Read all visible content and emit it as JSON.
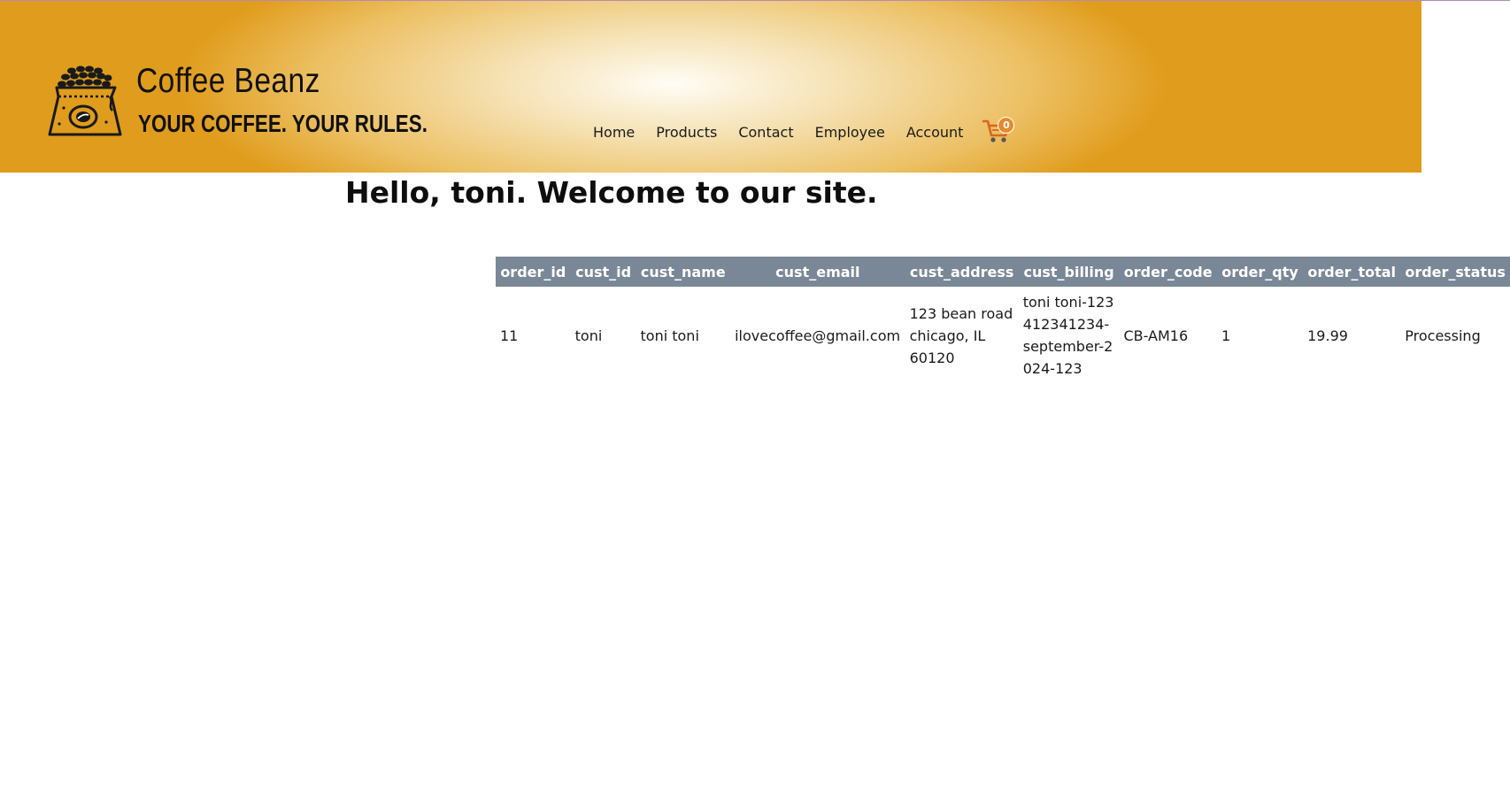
{
  "brand": {
    "name": "Coffee Beanz",
    "slogan": "YOUR COFFEE. YOUR RULES."
  },
  "nav": {
    "items": [
      "Home",
      "Products",
      "Contact",
      "Employee",
      "Account"
    ],
    "cart_count": "0",
    "cart_icon": "shopping-cart-icon"
  },
  "welcome": "Hello, toni. Welcome to our site.",
  "orders": {
    "columns": [
      "order_id",
      "cust_id",
      "cust_name",
      "cust_email",
      "cust_address",
      "cust_billing",
      "order_code",
      "order_qty",
      "order_total",
      "order_status"
    ],
    "rows": [
      {
        "order_id": "11",
        "cust_id": "toni",
        "cust_name": "toni toni",
        "cust_email": "ilovecoffee@gmail.com",
        "cust_address": "123 bean road chicago, IL 60120",
        "cust_billing": "toni toni-123412341234-september-2024-123",
        "order_code": "CB-AM16",
        "order_qty": "1",
        "order_total": "19.99",
        "order_status": "Processing"
      }
    ]
  },
  "colors": {
    "header_light": "#fffdf6",
    "header_dark": "#e09c1c",
    "table_header": "#7a8797",
    "cart_badge": "#e58b2e"
  }
}
